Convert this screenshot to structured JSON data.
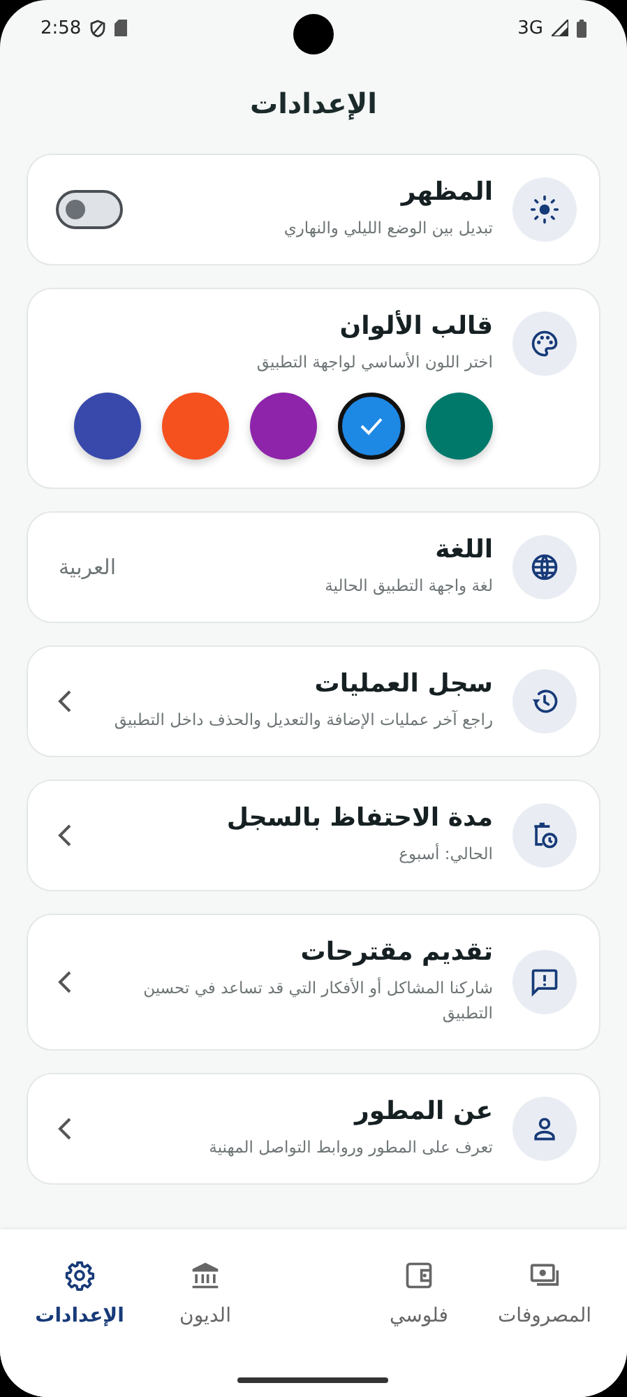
{
  "status_bar": {
    "time": "2:58",
    "network": "3G"
  },
  "title": "الإعدادات",
  "settings": [
    {
      "kind": "toggle",
      "title": "المظهر",
      "subtitle": "تبديل بين الوضع الليلي والنهاري",
      "on": false
    },
    {
      "kind": "colors",
      "title": "قالب الألوان",
      "subtitle": "اختر اللون الأساسي لواجهة التطبيق",
      "colors": [
        {
          "color": "#00796b",
          "selected": false
        },
        {
          "color": "#1e88e5",
          "selected": true
        },
        {
          "color": "#8e24aa",
          "selected": false
        },
        {
          "color": "#f4511e",
          "selected": false
        },
        {
          "color": "#3949ab",
          "selected": false
        }
      ]
    },
    {
      "kind": "value",
      "title": "اللغة",
      "subtitle": "لغة واجهة التطبيق الحالية",
      "value": "العربية"
    },
    {
      "kind": "link",
      "title": "سجل العمليات",
      "subtitle": "راجع آخر عمليات الإضافة والتعديل والحذف داخل التطبيق"
    },
    {
      "kind": "link",
      "title": "مدة الاحتفاظ بالسجل",
      "subtitle": "الحالي: أسبوع"
    },
    {
      "kind": "link",
      "title": "تقديم مقترحات",
      "subtitle": "شاركنا المشاكل أو الأفكار التي قد تساعد في تحسين التطبيق"
    },
    {
      "kind": "link",
      "title": "عن المطور",
      "subtitle": "تعرف على المطور وروابط التواصل المهنية"
    }
  ],
  "nav": [
    {
      "label": "المصروفات",
      "selected": false
    },
    {
      "label": "فلوسي",
      "selected": false
    },
    {
      "label": "الديون",
      "selected": false
    },
    {
      "label": "الإعدادات",
      "selected": true
    }
  ]
}
